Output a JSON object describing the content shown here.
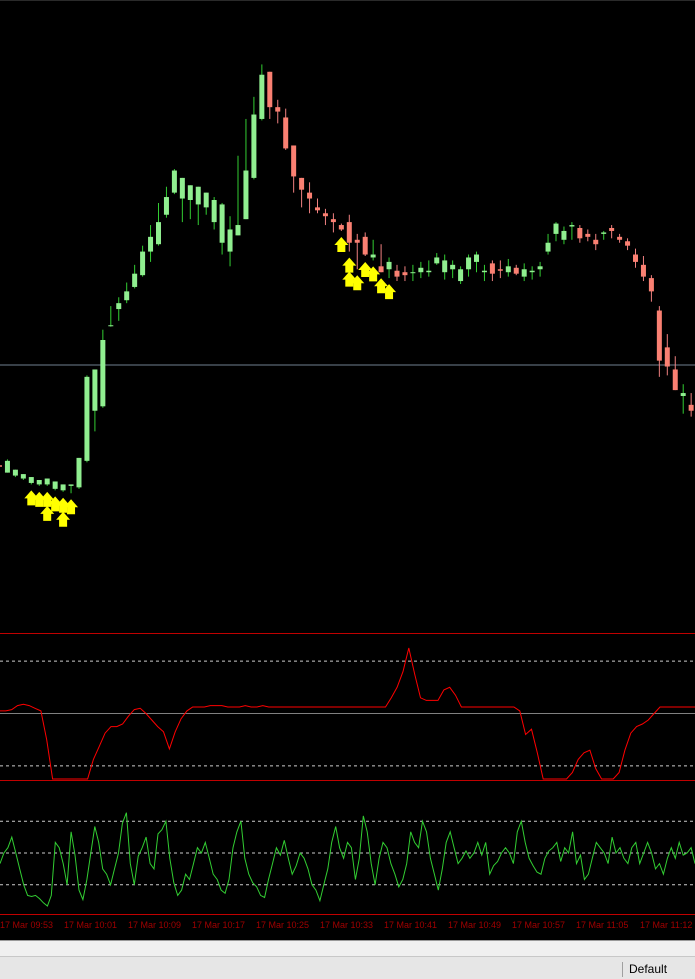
{
  "chart_data": [
    {
      "type": "candlestick",
      "panel": "price",
      "colors": {
        "bull": "#90ee90",
        "bear": "#fa8072",
        "wick_bull": "#32cd32",
        "wick_bear": "#f08080",
        "signal_arrow": "#ffff00",
        "hline": "#708090",
        "background": "#000000"
      },
      "ohlc_relative": [
        [
          105,
          104,
          103,
          102
        ],
        [
          100,
          108,
          101,
          109
        ],
        [
          98,
          102,
          97,
          101
        ],
        [
          96,
          99,
          95,
          98
        ],
        [
          93,
          97,
          92,
          96
        ],
        [
          92,
          95,
          91,
          94
        ],
        [
          92,
          96,
          91,
          95
        ],
        [
          89,
          94,
          88,
          93
        ],
        [
          88,
          92,
          87,
          91
        ],
        [
          91,
          92,
          86,
          87
        ],
        [
          90,
          110,
          89,
          108
        ],
        [
          108,
          165,
          107,
          166
        ],
        [
          142,
          170,
          128,
          146
        ],
        [
          145,
          190,
          144,
          197
        ],
        [
          200,
          200,
          199,
          213
        ],
        [
          211,
          215,
          203,
          219
        ],
        [
          217,
          223,
          215,
          229
        ],
        [
          226,
          235,
          225,
          241
        ],
        [
          234,
          250,
          233,
          254
        ],
        [
          250,
          260,
          243,
          268
        ],
        [
          255,
          270,
          254,
          283
        ],
        [
          275,
          287,
          273,
          294
        ],
        [
          290,
          305,
          289,
          306
        ],
        [
          286,
          300,
          270,
          290
        ],
        [
          285,
          295,
          272,
          295
        ],
        [
          282,
          294,
          268,
          289
        ],
        [
          280,
          290,
          275,
          288
        ],
        [
          270,
          285,
          265,
          287
        ],
        [
          256,
          282,
          248,
          283
        ],
        [
          250,
          265,
          240,
          274
        ],
        [
          261,
          268,
          267,
          315
        ],
        [
          272,
          305,
          300,
          340
        ],
        [
          300,
          343,
          299,
          355
        ],
        [
          340,
          370,
          339,
          377
        ],
        [
          372,
          348,
          340,
          367
        ],
        [
          348,
          345,
          337,
          353
        ],
        [
          341,
          320,
          319,
          347
        ],
        [
          322,
          301,
          290,
          310
        ],
        [
          300,
          292,
          280,
          298
        ],
        [
          290,
          286,
          276,
          297
        ],
        [
          280,
          278,
          276,
          286
        ],
        [
          276,
          274,
          268,
          279
        ],
        [
          272,
          270,
          263,
          276
        ],
        [
          268,
          265,
          264,
          269
        ],
        [
          270,
          256,
          250,
          275
        ],
        [
          258,
          256,
          238,
          262
        ],
        [
          260,
          248,
          247,
          263
        ],
        [
          246,
          248,
          244,
          258
        ],
        [
          240,
          236,
          236,
          255
        ],
        [
          238,
          243,
          232,
          246
        ],
        [
          237,
          233,
          230,
          241
        ],
        [
          236,
          234,
          230,
          240
        ],
        [
          236,
          236,
          230,
          241
        ],
        [
          236,
          239,
          232,
          243
        ],
        [
          236,
          237,
          233,
          244
        ],
        [
          242,
          246,
          241,
          249
        ],
        [
          236,
          244,
          231,
          248
        ],
        [
          238,
          241,
          232,
          244
        ],
        [
          230,
          238,
          228,
          240
        ],
        [
          238,
          246,
          233,
          248
        ],
        [
          243,
          248,
          236,
          250
        ],
        [
          236,
          237,
          230,
          241
        ],
        [
          242,
          235,
          230,
          244
        ],
        [
          238,
          237,
          232,
          244
        ],
        [
          236,
          240,
          233,
          245
        ],
        [
          239,
          235,
          234,
          241
        ],
        [
          233,
          238,
          230,
          242
        ],
        [
          236,
          237,
          231,
          240
        ],
        [
          238,
          240,
          233,
          243
        ],
        [
          250,
          256,
          248,
          262
        ],
        [
          262,
          269,
          257,
          270
        ],
        [
          258,
          264,
          255,
          267
        ],
        [
          267,
          268,
          258,
          270
        ],
        [
          266,
          259,
          256,
          268
        ],
        [
          262,
          260,
          257,
          265
        ],
        [
          258,
          255,
          251,
          262
        ],
        [
          262,
          263,
          258,
          264
        ],
        [
          266,
          264,
          259,
          268
        ],
        [
          260,
          258,
          256,
          262
        ],
        [
          257,
          254,
          251,
          259
        ],
        [
          248,
          243,
          239,
          252
        ],
        [
          241,
          233,
          230,
          247
        ],
        [
          232,
          223,
          216,
          234
        ],
        [
          210,
          176,
          165,
          213
        ],
        [
          185,
          172,
          166,
          194
        ],
        [
          170,
          156,
          160,
          179
        ],
        [
          152,
          154,
          140,
          160
        ],
        [
          146,
          142,
          138,
          154
        ],
        [
          132,
          120,
          108,
          136
        ],
        [
          120,
          103,
          94,
          124
        ],
        [
          98,
          68,
          60,
          104
        ],
        [
          70,
          55,
          50,
          79
        ],
        [
          58,
          52,
          51,
          65
        ],
        [
          54,
          61,
          47,
          72
        ],
        [
          64,
          73,
          61,
          90
        ],
        [
          80,
          129,
          71,
          155
        ],
        [
          127,
          121,
          114,
          131
        ],
        [
          120,
          111,
          104,
          128
        ],
        [
          108,
          112,
          103,
          121
        ],
        [
          110,
          106,
          103,
          118
        ]
      ],
      "horizontal_line_value": 173,
      "up_arrow_signals_on_bars": [
        4,
        5,
        6,
        6,
        7,
        8,
        8,
        9,
        43,
        44,
        44,
        45,
        46,
        47,
        48,
        49
      ]
    },
    {
      "type": "line",
      "panel": "indicator_1",
      "color": "#ff0000",
      "levels": [
        90,
        50,
        10
      ],
      "values": [
        52,
        52,
        53,
        56,
        57,
        56,
        54,
        52,
        30,
        0,
        0,
        0,
        0,
        0,
        0,
        0,
        15,
        25,
        35,
        40,
        40,
        42,
        48,
        53,
        54,
        50,
        45,
        40,
        36,
        23,
        36,
        46,
        52,
        55,
        55,
        55,
        56,
        56,
        56,
        55,
        55,
        55,
        56,
        55,
        55,
        56,
        55,
        55,
        55,
        55,
        55,
        55,
        55,
        55,
        55,
        55,
        55,
        55,
        55,
        55,
        55,
        55,
        55,
        55,
        55,
        55,
        55,
        62,
        70,
        82,
        100,
        80,
        62,
        60,
        60,
        60,
        68,
        70,
        64,
        55,
        55,
        55,
        55,
        55,
        55,
        55,
        55,
        55,
        55,
        52,
        34,
        38,
        20,
        0,
        0,
        0,
        0,
        0,
        5,
        15,
        20,
        22,
        8,
        0,
        0,
        0,
        5,
        22,
        35,
        40,
        42,
        45,
        50,
        55,
        55,
        55,
        55,
        55,
        55,
        55
      ]
    },
    {
      "type": "line",
      "panel": "indicator_2",
      "color": "#32cd32",
      "levels": [
        80,
        50,
        20
      ],
      "values": [
        40,
        50,
        55,
        65,
        50,
        35,
        20,
        10,
        9,
        10,
        7,
        3,
        0,
        10,
        60,
        55,
        40,
        20,
        70,
        48,
        15,
        6,
        25,
        50,
        75,
        60,
        35,
        30,
        20,
        35,
        50,
        78,
        88,
        40,
        20,
        47,
        55,
        65,
        40,
        35,
        68,
        72,
        80,
        45,
        22,
        10,
        15,
        30,
        25,
        40,
        55,
        50,
        60,
        45,
        30,
        25,
        15,
        12,
        25,
        55,
        70,
        80,
        45,
        30,
        22,
        18,
        10,
        8,
        25,
        40,
        55,
        48,
        62,
        45,
        30,
        38,
        50,
        45,
        35,
        20,
        15,
        5,
        20,
        35,
        60,
        75,
        55,
        45,
        60,
        55,
        25,
        45,
        85,
        70,
        40,
        20,
        45,
        60,
        55,
        40,
        30,
        18,
        25,
        40,
        70,
        60,
        55,
        80,
        70,
        45,
        30,
        15,
        35,
        60,
        70,
        55,
        40,
        45,
        52,
        45,
        50,
        60,
        48,
        60,
        30,
        38,
        42,
        50,
        55,
        50,
        40,
        70,
        80,
        60,
        45,
        38,
        32,
        30,
        45,
        52,
        55,
        60,
        42,
        55,
        50,
        70,
        40,
        48,
        25,
        30,
        45,
        60,
        55,
        50,
        40,
        65,
        50,
        55,
        45,
        40,
        55,
        60,
        40,
        50,
        60,
        50,
        35,
        40,
        30,
        45,
        55,
        45,
        60,
        48,
        50,
        55,
        40
      ]
    },
    {
      "type": "axis",
      "panel": "time_axis",
      "tick_labels": [
        "17 Mar 09:53",
        "17 Mar 10:01",
        "17 Mar 10:09",
        "17 Mar 10:17",
        "17 Mar 10:25",
        "17 Mar 10:33",
        "17 Mar 10:41",
        "17 Mar 10:49",
        "17 Mar 10:57",
        "17 Mar 11:05",
        "17 Mar 11:12"
      ]
    }
  ],
  "statusbar": {
    "profile": "Default"
  }
}
